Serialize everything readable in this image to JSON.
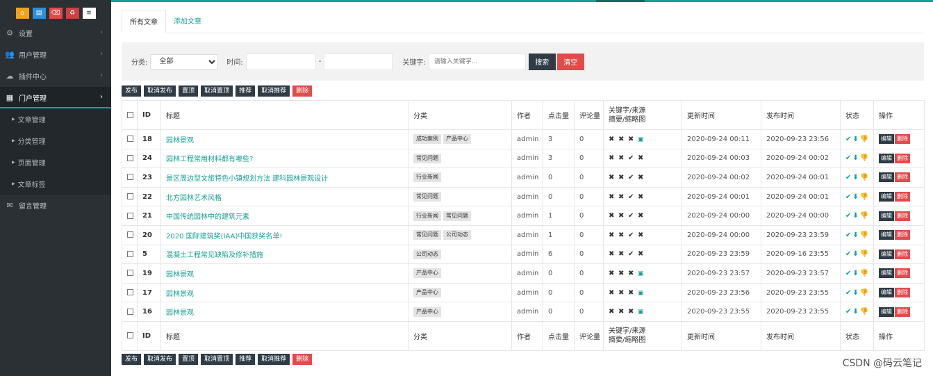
{
  "quick_buttons": [
    {
      "icon": "home-icon",
      "glyph": "⌂"
    },
    {
      "icon": "file-icon",
      "glyph": "▤"
    },
    {
      "icon": "trash-icon",
      "glyph": "⌫"
    },
    {
      "icon": "recycle-icon",
      "glyph": "♻"
    },
    {
      "icon": "list-icon",
      "glyph": "≡"
    }
  ],
  "sidebar": {
    "items": [
      {
        "label": "设置",
        "icon": "gear-icon"
      },
      {
        "label": "用户管理",
        "icon": "users-icon"
      },
      {
        "label": "插件中心",
        "icon": "cloud-icon"
      },
      {
        "label": "门户管理",
        "icon": "grid-icon",
        "active": true
      },
      {
        "label": "留言管理",
        "icon": "mail-icon"
      }
    ],
    "sub_items": [
      "文章管理",
      "分类管理",
      "页面管理",
      "文章标签"
    ]
  },
  "tabs": [
    "所有文章",
    "添加文章"
  ],
  "filter": {
    "category_label": "分类:",
    "category_value": "全部",
    "time_label": "时间:",
    "time_sep": "-",
    "keyword_label": "关键字:",
    "keyword_placeholder": "请输入关键字...",
    "search": "搜索",
    "clear": "清空"
  },
  "actions": [
    "发布",
    "取消发布",
    "置顶",
    "取消置顶",
    "推荐",
    "取消推荐",
    "删除"
  ],
  "table": {
    "headers": {
      "id": "ID",
      "title": "标题",
      "category": "分类",
      "author": "作者",
      "clicks": "点击量",
      "comments": "评论量",
      "flags_line1": "关键字/来源",
      "flags_line2": "摘要/缩略图",
      "updated": "更新时间",
      "published": "发布时间",
      "status": "状态",
      "ops": "操作"
    },
    "edit_label": "编辑",
    "delete_label": "删除",
    "rows": [
      {
        "id": "18",
        "title": "园林景观",
        "tags": [
          "成功案例",
          "产品中心"
        ],
        "author": "admin",
        "clicks": "3",
        "comments": "0",
        "flags": [
          "✖",
          "✖",
          "✖",
          "▣"
        ],
        "updated": "2020-09-24 00:11",
        "published": "2020-09-23 23:56"
      },
      {
        "id": "24",
        "title": "园林工程常用材料都有哪些?",
        "tags": [
          "常见问题"
        ],
        "author": "admin",
        "clicks": "3",
        "comments": "0",
        "flags": [
          "✖",
          "✖",
          "✔",
          "✖"
        ],
        "updated": "2020-09-24 00:03",
        "published": "2020-09-24 00:02"
      },
      {
        "id": "23",
        "title": "景区周边型文旅特色小镇规划方法 建科园林景观设计",
        "tags": [
          "行业新闻"
        ],
        "author": "admin",
        "clicks": "0",
        "comments": "0",
        "flags": [
          "✖",
          "✖",
          "✔",
          "✖"
        ],
        "updated": "2020-09-24 00:02",
        "published": "2020-09-24 00:01"
      },
      {
        "id": "22",
        "title": "北方园林艺术风格",
        "tags": [
          "常见问题"
        ],
        "author": "admin",
        "clicks": "0",
        "comments": "0",
        "flags": [
          "✖",
          "✖",
          "✔",
          "✖"
        ],
        "updated": "2020-09-24 00:01",
        "published": "2020-09-24 00:01"
      },
      {
        "id": "21",
        "title": "中国传统园林中的建筑元素",
        "tags": [
          "行业新闻",
          "常见问题"
        ],
        "author": "admin",
        "clicks": "1",
        "comments": "0",
        "flags": [
          "✖",
          "✖",
          "✔",
          "✖"
        ],
        "updated": "2020-09-24 00:00",
        "published": "2020-09-24 00:00"
      },
      {
        "id": "20",
        "title": "2020 国际建筑奖(IAA)中国获奖名单!",
        "tags": [
          "常见问题",
          "公司动态"
        ],
        "author": "admin",
        "clicks": "1",
        "comments": "0",
        "flags": [
          "✖",
          "✖",
          "✔",
          "✖"
        ],
        "updated": "2020-09-24 00:00",
        "published": "2020-09-23 23:59"
      },
      {
        "id": "5",
        "title": "混凝土工程常见缺陷及修补措施",
        "tags": [
          "公司动态"
        ],
        "author": "admin",
        "clicks": "6",
        "comments": "0",
        "flags": [
          "✖",
          "✖",
          "✔",
          "✖"
        ],
        "updated": "2020-09-23 23:59",
        "published": "2020-09-16 23:55"
      },
      {
        "id": "19",
        "title": "园林景观",
        "tags": [
          "产品中心"
        ],
        "author": "admin",
        "clicks": "0",
        "comments": "0",
        "flags": [
          "✖",
          "✖",
          "✖",
          "▣"
        ],
        "updated": "2020-09-23 23:57",
        "published": "2020-09-23 23:57"
      },
      {
        "id": "17",
        "title": "园林景观",
        "tags": [
          "产品中心"
        ],
        "author": "admin",
        "clicks": "0",
        "comments": "0",
        "flags": [
          "✖",
          "✖",
          "✖",
          "▣"
        ],
        "updated": "2020-09-23 23:56",
        "published": "2020-09-23 23:55"
      },
      {
        "id": "16",
        "title": "园林景观",
        "tags": [
          "产品中心"
        ],
        "author": "admin",
        "clicks": "0",
        "comments": "0",
        "flags": [
          "✖",
          "✖",
          "✖",
          "▣"
        ],
        "updated": "2020-09-23 23:55",
        "published": "2020-09-23 23:55"
      }
    ]
  },
  "watermark": "CSDN @码云笔记",
  "colors": {
    "accent": "#1aa094",
    "sidebar": "#2b3034",
    "dark_button": "#2f3b45",
    "danger": "#e34b4b"
  }
}
